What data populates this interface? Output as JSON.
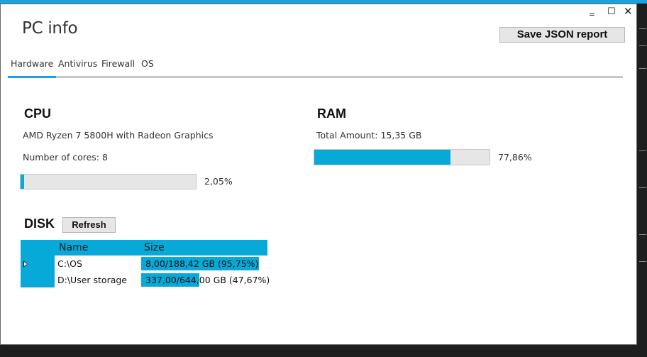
{
  "window": {
    "title": "PC info",
    "save_label": "Save JSON report",
    "controls": {
      "minimize": "‗",
      "maximize": "☐",
      "close": "✕"
    }
  },
  "tabs": [
    "Hardware",
    "Antivirus",
    "Firewall",
    "OS"
  ],
  "active_tab": "Hardware",
  "cpu": {
    "heading": "CPU",
    "model": "AMD Ryzen 7 5800H with Radeon Graphics",
    "cores_text": "Number of cores: 8",
    "usage_label": "2,05%",
    "usage_fraction": 0.0205
  },
  "ram": {
    "heading": "RAM",
    "total_text": "Total Amount: 15,35 GB",
    "usage_label": "77,86%",
    "usage_fraction": 0.7786
  },
  "disk": {
    "heading": "DISK",
    "refresh_label": "Refresh",
    "columns": [
      "Name",
      "Size"
    ],
    "rows": [
      {
        "name": "C:\\OS",
        "size": "8,00/188,42 GB (95,75%)",
        "fill_fraction": 0.9575
      },
      {
        "name": "D:\\User storage",
        "size": "337,00/644,00 GB (47,67%)",
        "fill_fraction": 0.4767
      }
    ]
  },
  "colors": {
    "accent": "#06a9d8",
    "title_strip": "#1ba1e2",
    "bar_track": "#e6e6e6",
    "background_dark": "#1e1e1e"
  }
}
